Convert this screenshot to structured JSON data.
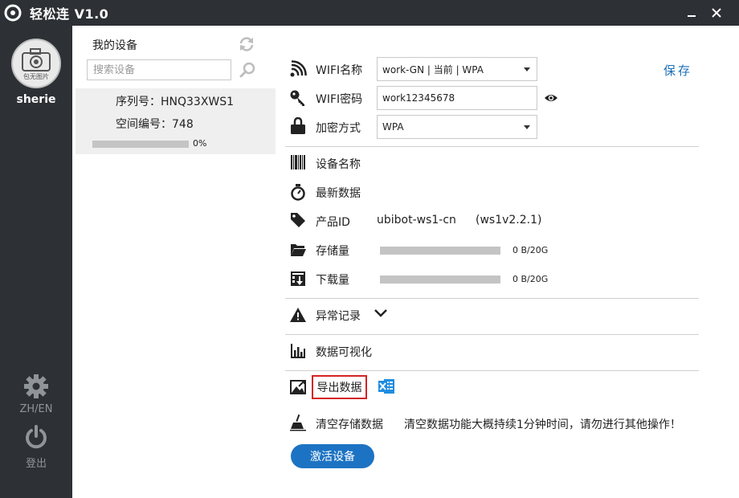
{
  "app": {
    "title": "轻松连 V1.0"
  },
  "user": {
    "avatar_caption": "包无图片",
    "name": "sherie"
  },
  "nav": {
    "lang_label": "ZH/EN",
    "logout_label": "登出"
  },
  "devices": {
    "title": "我的设备",
    "search_placeholder": "搜索设备",
    "items": [
      {
        "serial": "序列号：HNQ33XWS1",
        "space": "空间编号：748",
        "progress": 0,
        "progress_label": "0%"
      }
    ]
  },
  "wifi": {
    "name_label": "WIFI名称",
    "name_value": "work-GN | 当前 | WPA",
    "password_label": "WIFI密码",
    "password_value": "work12345678",
    "encryption_label": "加密方式",
    "encryption_value": "WPA",
    "save_label": "保存"
  },
  "device_info": {
    "name_label": "设备名称",
    "latest_label": "最新数据",
    "product_label": "产品ID",
    "product_value": "ubibot-ws1-cn",
    "version_value": "(ws1v2.2.1)",
    "storage_label": "存储量",
    "storage_value": "0 B/20G",
    "storage_fraction": 0,
    "download_label": "下载量",
    "download_value": "0 B/20G",
    "download_fraction": 0
  },
  "sections": {
    "anomaly_label": "异常记录",
    "visualize_label": "数据可视化",
    "export_label": "导出数据",
    "clear_label": "清空存储数据",
    "clear_warning": "清空数据功能大概持续1分钟时间，请勿进行其他操作！",
    "activate_label": "激活设备"
  },
  "colors": {
    "sidebar_bg": "#2d3034",
    "accent_blue": "#1d73c3",
    "export_border": "#d42323",
    "device_card_bg": "#efefef"
  },
  "icons": [
    "app-logo-icon",
    "minimize-icon",
    "close-icon",
    "camera-icon",
    "gear-icon",
    "power-icon",
    "refresh-icon",
    "search-icon",
    "wifi-icon",
    "key-icon",
    "lock-icon",
    "eye-icon",
    "barcode-icon",
    "stopwatch-icon",
    "tag-icon",
    "folder-icon",
    "download-icon",
    "warning-icon",
    "chevron-down-icon",
    "bar-chart-icon",
    "export-icon",
    "excel-icon",
    "broom-icon"
  ]
}
